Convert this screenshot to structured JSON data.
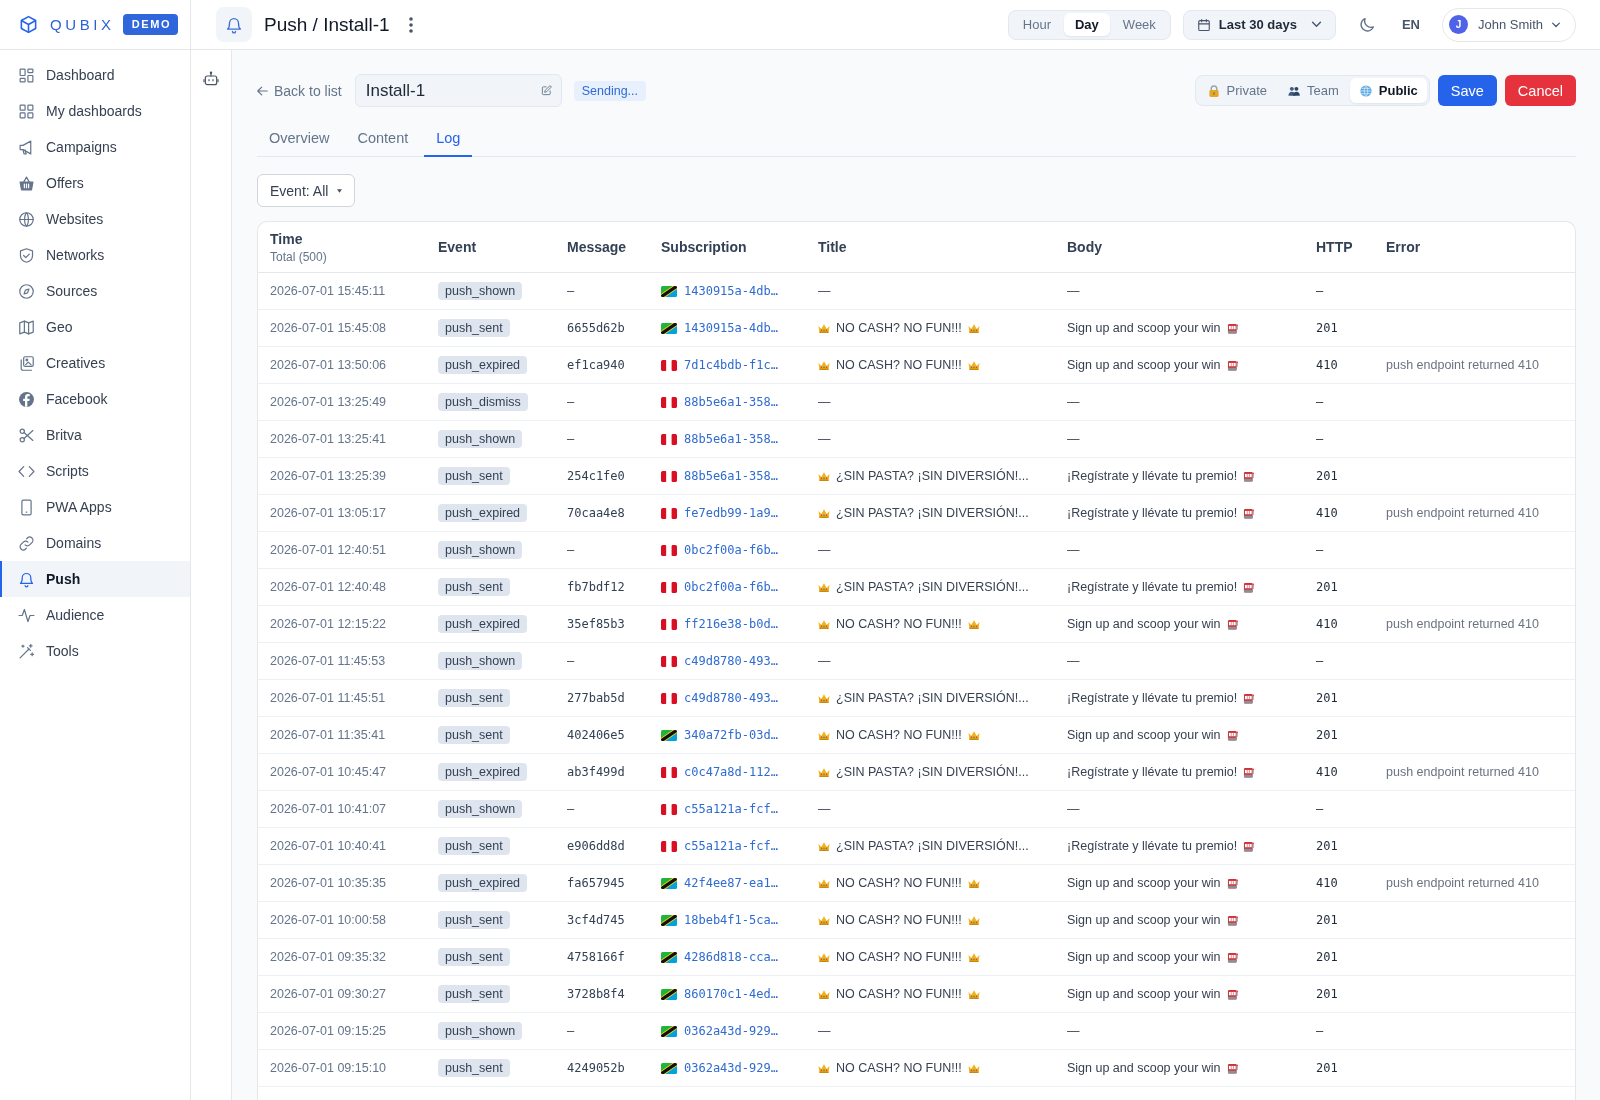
{
  "sidebar": {
    "brand": {
      "name": "QUBIX",
      "badge": "DEMO"
    },
    "items": [
      {
        "label": "Dashboard",
        "selected": false
      },
      {
        "label": "My dashboards",
        "selected": false
      },
      {
        "label": "Campaigns",
        "selected": false
      },
      {
        "label": "Offers",
        "selected": false
      },
      {
        "label": "Websites",
        "selected": false
      },
      {
        "label": "Networks",
        "selected": false
      },
      {
        "label": "Sources",
        "selected": false
      },
      {
        "label": "Geo",
        "selected": false
      },
      {
        "label": "Creatives",
        "selected": false
      },
      {
        "label": "Facebook",
        "selected": false
      },
      {
        "label": "Britva",
        "selected": false
      },
      {
        "label": "Scripts",
        "selected": false
      },
      {
        "label": "PWA Apps",
        "selected": false
      },
      {
        "label": "Domains",
        "selected": false
      },
      {
        "label": "Push",
        "selected": true
      },
      {
        "label": "Audience",
        "selected": false
      },
      {
        "label": "Tools",
        "selected": false
      }
    ]
  },
  "topbar": {
    "title": "Push / Install-1",
    "granularity": [
      {
        "label": "Hour",
        "selected": false
      },
      {
        "label": "Day",
        "selected": true
      },
      {
        "label": "Week",
        "selected": false
      }
    ],
    "date_range": "Last 30 days",
    "language": "EN",
    "user": {
      "initial": "J",
      "name": "John Smith"
    }
  },
  "editor": {
    "back_link": "Back to list",
    "name_field": {
      "value": "Install-1"
    },
    "status": "Sending...",
    "visibility": [
      {
        "label": "Private",
        "selected": false
      },
      {
        "label": "Team",
        "selected": false
      },
      {
        "label": "Public",
        "selected": true
      }
    ],
    "buttons": [
      {
        "label": "Save",
        "kind": "primary"
      },
      {
        "label": "Cancel",
        "kind": "danger"
      }
    ]
  },
  "tabs": [
    {
      "label": "Overview",
      "selected": false
    },
    {
      "label": "Content",
      "selected": false
    },
    {
      "label": "Log",
      "selected": true
    }
  ],
  "filter": {
    "label": "Event: All"
  },
  "table": {
    "columns": [
      {
        "label": "Time",
        "subtitle": "Total (500)"
      },
      {
        "label": "Event"
      },
      {
        "label": "Message"
      },
      {
        "label": "Subscription"
      },
      {
        "label": "Title"
      },
      {
        "label": "Body"
      },
      {
        "label": "HTTP"
      },
      {
        "label": "Error"
      }
    ],
    "rows": [
      {
        "time": "2026-07-01 15:45:11",
        "event": "push_shown",
        "message": "–",
        "subscription": {
          "kind": "tanzania",
          "id": "1430915a-4db…"
        },
        "title": {
          "text": "—",
          "icon_before": false,
          "icon_after": false
        },
        "body": {
          "text": "—",
          "icon_after": false
        },
        "http": "–"
      },
      {
        "time": "2026-07-01 15:45:08",
        "event": "push_sent",
        "message": "6655d62b",
        "subscription": {
          "kind": "tanzania",
          "id": "1430915a-4db…"
        },
        "title": {
          "text": "NO CASH? NO FUN!!!",
          "icon_before": true,
          "icon_after": true
        },
        "body": {
          "text": "Sign up and scoop your win",
          "icon_after": true
        },
        "http": "201"
      },
      {
        "time": "2026-07-01 13:50:06",
        "event": "push_expired",
        "message": "ef1ca940",
        "subscription": {
          "kind": "peru",
          "id": "7d1c4bdb-f1c…"
        },
        "title": {
          "text": "NO CASH? NO FUN!!!",
          "icon_before": true,
          "icon_after": true
        },
        "body": {
          "text": "Sign up and scoop your win",
          "icon_after": true
        },
        "http": "410",
        "error": "push endpoint returned 410"
      },
      {
        "time": "2026-07-01 13:25:49",
        "event": "push_dismiss",
        "message": "–",
        "subscription": {
          "kind": "peru",
          "id": "88b5e6a1-358…"
        },
        "title": {
          "text": "—",
          "icon_before": false,
          "icon_after": false
        },
        "body": {
          "text": "—",
          "icon_after": false
        },
        "http": "–"
      },
      {
        "time": "2026-07-01 13:25:41",
        "event": "push_shown",
        "message": "–",
        "subscription": {
          "kind": "peru",
          "id": "88b5e6a1-358…"
        },
        "title": {
          "text": "—",
          "icon_before": false,
          "icon_after": false
        },
        "body": {
          "text": "—",
          "icon_after": false
        },
        "http": "–"
      },
      {
        "time": "2026-07-01 13:25:39",
        "event": "push_sent",
        "message": "254c1fe0",
        "subscription": {
          "kind": "peru",
          "id": "88b5e6a1-358…"
        },
        "title": {
          "text": "¿SIN PASTA? ¡SIN DIVERSIÓN!...",
          "icon_before": true,
          "icon_after": false
        },
        "body": {
          "text": "¡Regístrate y llévate tu premio!",
          "icon_after": true
        },
        "http": "201"
      },
      {
        "time": "2026-07-01 13:05:17",
        "event": "push_expired",
        "message": "70caa4e8",
        "subscription": {
          "kind": "peru",
          "id": "fe7edb99-1a9…"
        },
        "title": {
          "text": "¿SIN PASTA? ¡SIN DIVERSIÓN!...",
          "icon_before": true,
          "icon_after": false
        },
        "body": {
          "text": "¡Regístrate y llévate tu premio!",
          "icon_after": true
        },
        "http": "410",
        "error": "push endpoint returned 410"
      },
      {
        "time": "2026-07-01 12:40:51",
        "event": "push_shown",
        "message": "–",
        "subscription": {
          "kind": "peru",
          "id": "0bc2f00a-f6b…"
        },
        "title": {
          "text": "—",
          "icon_before": false,
          "icon_after": false
        },
        "body": {
          "text": "—",
          "icon_after": false
        },
        "http": "–"
      },
      {
        "time": "2026-07-01 12:40:48",
        "event": "push_sent",
        "message": "fb7bdf12",
        "subscription": {
          "kind": "peru",
          "id": "0bc2f00a-f6b…"
        },
        "title": {
          "text": "¿SIN PASTA? ¡SIN DIVERSIÓN!...",
          "icon_before": true,
          "icon_after": false
        },
        "body": {
          "text": "¡Regístrate y llévate tu premio!",
          "icon_after": true
        },
        "http": "201"
      },
      {
        "time": "2026-07-01 12:15:22",
        "event": "push_expired",
        "message": "35ef85b3",
        "subscription": {
          "kind": "peru",
          "id": "ff216e38-b0d…"
        },
        "title": {
          "text": "NO CASH? NO FUN!!!",
          "icon_before": true,
          "icon_after": true
        },
        "body": {
          "text": "Sign up and scoop your win",
          "icon_after": true
        },
        "http": "410",
        "error": "push endpoint returned 410"
      },
      {
        "time": "2026-07-01 11:45:53",
        "event": "push_shown",
        "message": "–",
        "subscription": {
          "kind": "peru",
          "id": "c49d8780-493…"
        },
        "title": {
          "text": "—",
          "icon_before": false,
          "icon_after": false
        },
        "body": {
          "text": "—",
          "icon_after": false
        },
        "http": "–"
      },
      {
        "time": "2026-07-01 11:45:51",
        "event": "push_sent",
        "message": "277bab5d",
        "subscription": {
          "kind": "peru",
          "id": "c49d8780-493…"
        },
        "title": {
          "text": "¿SIN PASTA? ¡SIN DIVERSIÓN!...",
          "icon_before": true,
          "icon_after": false
        },
        "body": {
          "text": "¡Regístrate y llévate tu premio!",
          "icon_after": true
        },
        "http": "201"
      },
      {
        "time": "2026-07-01 11:35:41",
        "event": "push_sent",
        "message": "402406e5",
        "subscription": {
          "kind": "tanzania",
          "id": "340a72fb-03d…"
        },
        "title": {
          "text": "NO CASH? NO FUN!!!",
          "icon_before": true,
          "icon_after": true
        },
        "body": {
          "text": "Sign up and scoop your win",
          "icon_after": true
        },
        "http": "201"
      },
      {
        "time": "2026-07-01 10:45:47",
        "event": "push_expired",
        "message": "ab3f499d",
        "subscription": {
          "kind": "peru",
          "id": "c0c47a8d-112…"
        },
        "title": {
          "text": "¿SIN PASTA? ¡SIN DIVERSIÓN!...",
          "icon_before": true,
          "icon_after": false
        },
        "body": {
          "text": "¡Regístrate y llévate tu premio!",
          "icon_after": true
        },
        "http": "410",
        "error": "push endpoint returned 410"
      },
      {
        "time": "2026-07-01 10:41:07",
        "event": "push_shown",
        "message": "–",
        "subscription": {
          "kind": "peru",
          "id": "c55a121a-fcf…"
        },
        "title": {
          "text": "—",
          "icon_before": false,
          "icon_after": false
        },
        "body": {
          "text": "—",
          "icon_after": false
        },
        "http": "–"
      },
      {
        "time": "2026-07-01 10:40:41",
        "event": "push_sent",
        "message": "e906dd8d",
        "subscription": {
          "kind": "peru",
          "id": "c55a121a-fcf…"
        },
        "title": {
          "text": "¿SIN PASTA? ¡SIN DIVERSIÓN!...",
          "icon_before": true,
          "icon_after": false
        },
        "body": {
          "text": "¡Regístrate y llévate tu premio!",
          "icon_after": true
        },
        "http": "201"
      },
      {
        "time": "2026-07-01 10:35:35",
        "event": "push_expired",
        "message": "fa657945",
        "subscription": {
          "kind": "tanzania",
          "id": "42f4ee87-ea1…"
        },
        "title": {
          "text": "NO CASH? NO FUN!!!",
          "icon_before": true,
          "icon_after": true
        },
        "body": {
          "text": "Sign up and scoop your win",
          "icon_after": true
        },
        "http": "410",
        "error": "push endpoint returned 410"
      },
      {
        "time": "2026-07-01 10:00:58",
        "event": "push_sent",
        "message": "3cf4d745",
        "subscription": {
          "kind": "tanzania",
          "id": "18beb4f1-5ca…"
        },
        "title": {
          "text": "NO CASH? NO FUN!!!",
          "icon_before": true,
          "icon_after": true
        },
        "body": {
          "text": "Sign up and scoop your win",
          "icon_after": true
        },
        "http": "201"
      },
      {
        "time": "2026-07-01 09:35:32",
        "event": "push_sent",
        "message": "4758166f",
        "subscription": {
          "kind": "tanzania",
          "id": "4286d818-cca…"
        },
        "title": {
          "text": "NO CASH? NO FUN!!!",
          "icon_before": true,
          "icon_after": true
        },
        "body": {
          "text": "Sign up and scoop your win",
          "icon_after": true
        },
        "http": "201"
      },
      {
        "time": "2026-07-01 09:30:27",
        "event": "push_sent",
        "message": "3728b8f4",
        "subscription": {
          "kind": "tanzania",
          "id": "860170c1-4ed…"
        },
        "title": {
          "text": "NO CASH? NO FUN!!!",
          "icon_before": true,
          "icon_after": true
        },
        "body": {
          "text": "Sign up and scoop your win",
          "icon_after": true
        },
        "http": "201"
      },
      {
        "time": "2026-07-01 09:15:25",
        "event": "push_shown",
        "message": "–",
        "subscription": {
          "kind": "tanzania",
          "id": "0362a43d-929…"
        },
        "title": {
          "text": "—",
          "icon_before": false,
          "icon_after": false
        },
        "body": {
          "text": "—",
          "icon_after": false
        },
        "http": "–"
      },
      {
        "time": "2026-07-01 09:15:10",
        "event": "push_sent",
        "message": "4249052b",
        "subscription": {
          "kind": "tanzania",
          "id": "0362a43d-929…"
        },
        "title": {
          "text": "NO CASH? NO FUN!!!",
          "icon_before": true,
          "icon_after": true
        },
        "body": {
          "text": "Sign up and scoop your win",
          "icon_after": true
        },
        "http": "201"
      }
    ]
  }
}
